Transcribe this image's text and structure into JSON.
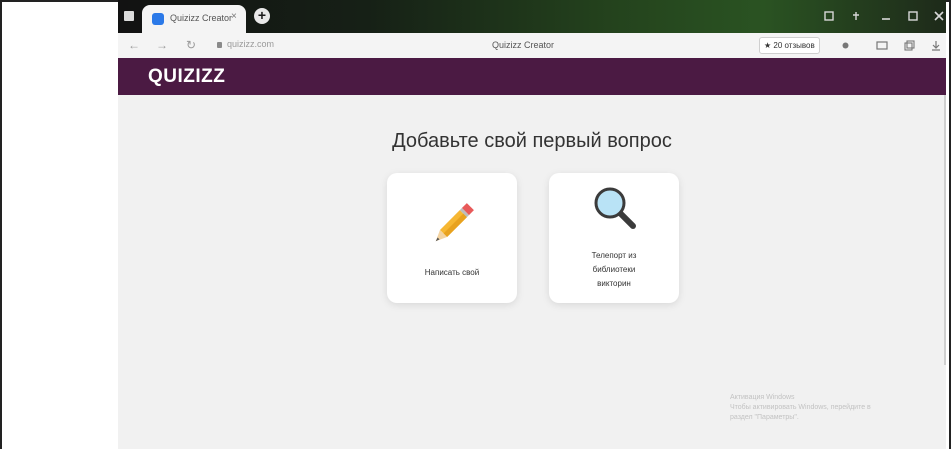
{
  "browser": {
    "tab_title": "Quizizz Creator",
    "tab_close": "×",
    "new_tab": "+",
    "url": "quizizz.com",
    "page_title": "Quizizz Creator",
    "reviews_badge": "★ 20 отзывов",
    "nav": {
      "back": "←",
      "forward": "→",
      "reload": "↻"
    }
  },
  "app": {
    "logo": "QUIZIZZ",
    "heading": "Добавьте свой первый вопрос",
    "options": [
      {
        "label": "Написать свой",
        "icon": "pencil-icon"
      },
      {
        "label": "Телепорт из библиотеки викторин",
        "label_lines": [
          "Телепорт из",
          "библиотеки",
          "викторин"
        ],
        "icon": "magnifier-icon"
      }
    ]
  },
  "watermark": {
    "line1": "Активация Windows",
    "line2": "Чтобы активировать Windows, перейдите в",
    "line3": "раздел \"Параметры\"."
  },
  "colors": {
    "header": "#4b1a43",
    "card": "#ffffff",
    "background": "#f1f1f1"
  }
}
